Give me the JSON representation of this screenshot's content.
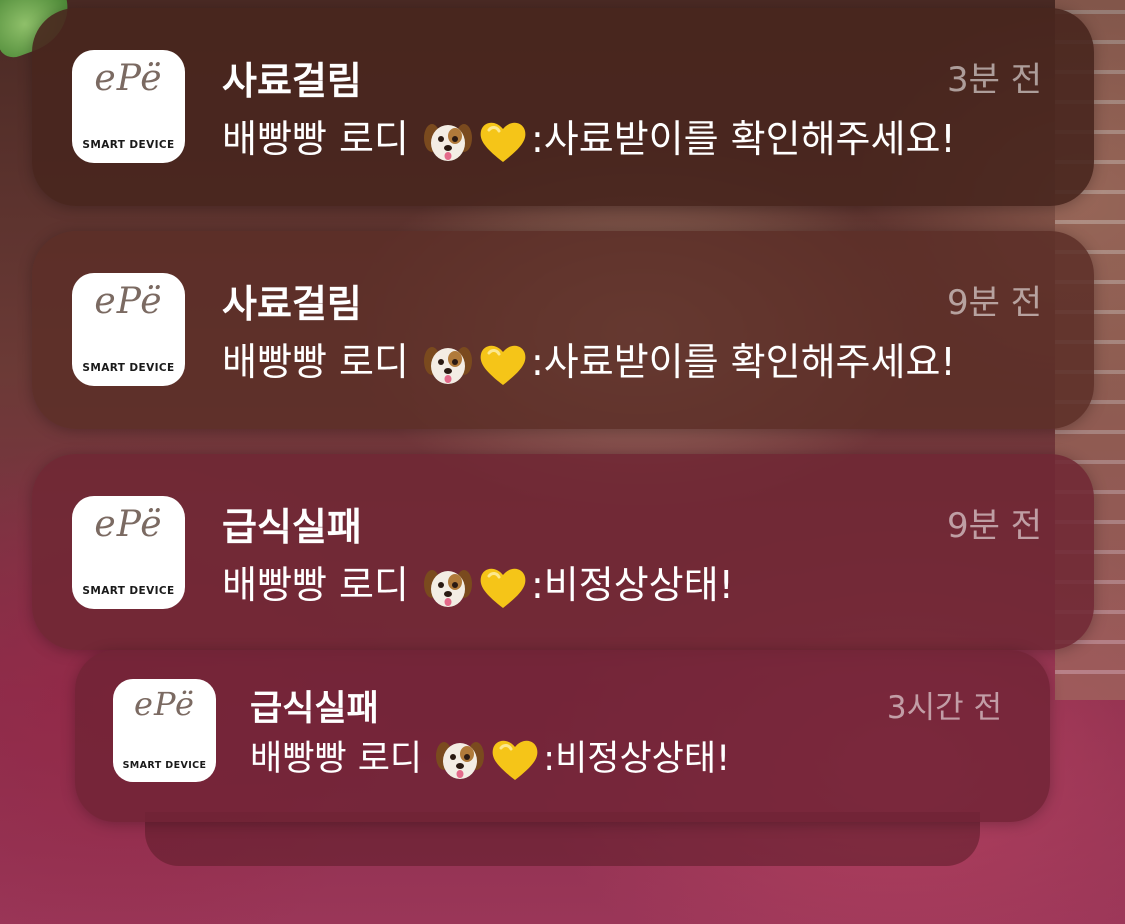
{
  "app": {
    "logo_text": "ePë",
    "logo_subtitle": "SMART DEVICE"
  },
  "notifications": [
    {
      "title": "사료걸림",
      "message_prefix": "배빵빵 로디",
      "message_suffix": ":사료받이를 확인해주세요!",
      "time": "3분 전"
    },
    {
      "title": "사료걸림",
      "message_prefix": "배빵빵 로디",
      "message_suffix": ":사료받이를 확인해주세요!",
      "time": "9분 전"
    },
    {
      "title": "급식실패",
      "message_prefix": "배빵빵 로디",
      "message_suffix": ":비정상상태!",
      "time": "9분 전"
    },
    {
      "title": "급식실패",
      "message_prefix": "배빵빵 로디",
      "message_suffix": ":비정상상태!",
      "time": "3시간 전"
    }
  ],
  "emoji": {
    "dog_icon": "dog-face-emoji",
    "heart_icon": "yellow-heart-emoji",
    "heart_color": "#F5C518"
  },
  "colors": {
    "title": "#FFFFFF",
    "time": "#B9A3A6"
  }
}
